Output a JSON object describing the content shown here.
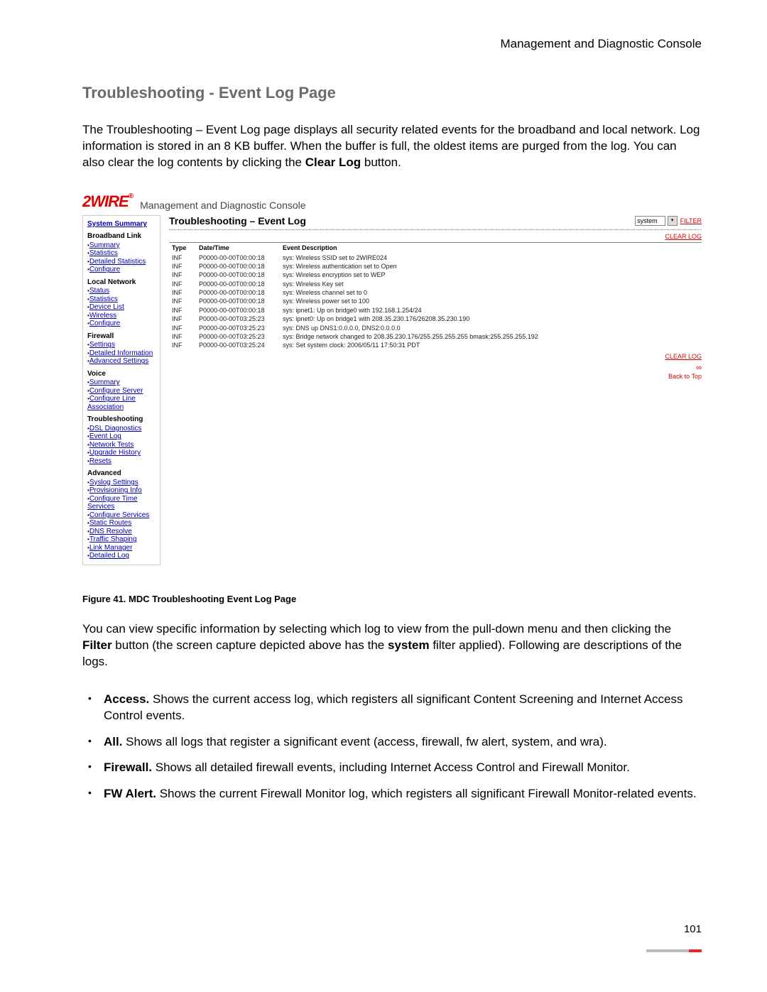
{
  "header": {
    "right": "Management and Diagnostic Console"
  },
  "title": "Troubleshooting - Event Log Page",
  "intro": {
    "text1": "The Troubleshooting – Event Log page displays all security related events for the broadband and local network. Log information is stored in an 8 KB buffer. When the buffer is full, the oldest items are purged from the log. You can also clear the log contents by clicking the ",
    "clear_log_bold": "Clear Log",
    "text2": " button."
  },
  "console": {
    "brand": "2WIRE",
    "title": "Management and Diagnostic Console",
    "sidebar": {
      "top": "System Summary",
      "groups": [
        {
          "title": "Broadband Link",
          "items": [
            "Summary",
            "Statistics",
            "Detailed Statistics",
            "Configure"
          ]
        },
        {
          "title": "Local Network",
          "items": [
            "Status",
            "Statistics",
            "Device List",
            "Wireless",
            "Configure"
          ]
        },
        {
          "title": "Firewall",
          "items": [
            "Settings",
            "Detailed Information",
            "Advanced Settings"
          ]
        },
        {
          "title": "Voice",
          "items": [
            "Summary",
            "Configure Server",
            "Configure Line Association"
          ]
        },
        {
          "title": "Troubleshooting",
          "items": [
            "DSL Diagnostics",
            "Event Log",
            "Network Tests",
            "Upgrade History",
            "Resets"
          ]
        },
        {
          "title": "Advanced",
          "items": [
            "Syslog Settings",
            "Provisioning Info",
            "Configure Time Services",
            "Configure Services",
            "Static Routes",
            "DNS Resolve",
            "Traffic Shaping",
            "Link Manager",
            "Detailed Log"
          ]
        }
      ]
    },
    "content": {
      "heading": "Troubleshooting – Event Log",
      "filter_value": "system",
      "filter_btn": "FILTER",
      "clear_btn": "CLEAR LOG",
      "cols": {
        "type": "Type",
        "datetime": "Date/Time",
        "desc": "Event Description"
      },
      "rows": [
        {
          "t": "INF",
          "d": "P0000-00-00T00:00:18",
          "e": "sys:  Wireless SSID set to 2WIRE024"
        },
        {
          "t": "INF",
          "d": "P0000-00-00T00:00:18",
          "e": "sys:  Wireless authentication set to Open"
        },
        {
          "t": "INF",
          "d": "P0000-00-00T00:00:18",
          "e": "sys:  Wireless encryption set to WEP"
        },
        {
          "t": "INF",
          "d": "P0000-00-00T00:00:18",
          "e": "sys:  Wireless Key set"
        },
        {
          "t": "INF",
          "d": "P0000-00-00T00:00:18",
          "e": "sys:  Wireless channel set to 0"
        },
        {
          "t": "INF",
          "d": "P0000-00-00T00:00:18",
          "e": "sys:  Wireless power set to 100"
        },
        {
          "t": "INF",
          "d": "P0000-00-00T00:00:18",
          "e": "sys:  ipnet1: Up on bridge0 with 192.168.1.254/24"
        },
        {
          "t": "INF",
          "d": "P0000-00-00T03:25:23",
          "e": "sys:  ipnet0: Up on bridge1 with 208.35.230.176/26208.35.230.190"
        },
        {
          "t": "INF",
          "d": "P0000-00-00T03:25:23",
          "e": "sys:  DNS up DNS1:0.0.0.0, DNS2:0.0.0.0"
        },
        {
          "t": "INF",
          "d": "P0000-00-00T03:25:23",
          "e": "sys:  Bridge network changed to 208.35.230.176/255.255.255.255 bmask:255.255.255.192"
        },
        {
          "t": "INF",
          "d": "P0000-00-00T03:25:24",
          "e": "sys:  Set system clock: 2006/05/11 17:50:31 PDT"
        }
      ],
      "back_to_top": "Back to Top"
    }
  },
  "figure_caption": "Figure 41. MDC Troubleshooting Event Log Page",
  "para2": {
    "t1": "You can view specific information by selecting which log to view from the pull-down menu and then clicking the ",
    "b1": "Filter",
    "t2": " button (the screen capture depicted above has the ",
    "b2": "system",
    "t3": " filter applied). Following are descriptions of the logs."
  },
  "descs": [
    {
      "b": "Access.",
      "t": " Shows the current access log, which registers all significant Content Screening and Internet Access Control events."
    },
    {
      "b": "All.",
      "t": " Shows all logs that register a significant event (access, firewall, fw alert, system, and wra)."
    },
    {
      "b": "Firewall.",
      "t": " Shows all detailed firewall events, including Internet Access Control and Firewall Monitor."
    },
    {
      "b": "FW Alert.",
      "t": " Shows the current Firewall Monitor log, which registers all significant Firewall Monitor-related events."
    }
  ],
  "page_number": "101"
}
